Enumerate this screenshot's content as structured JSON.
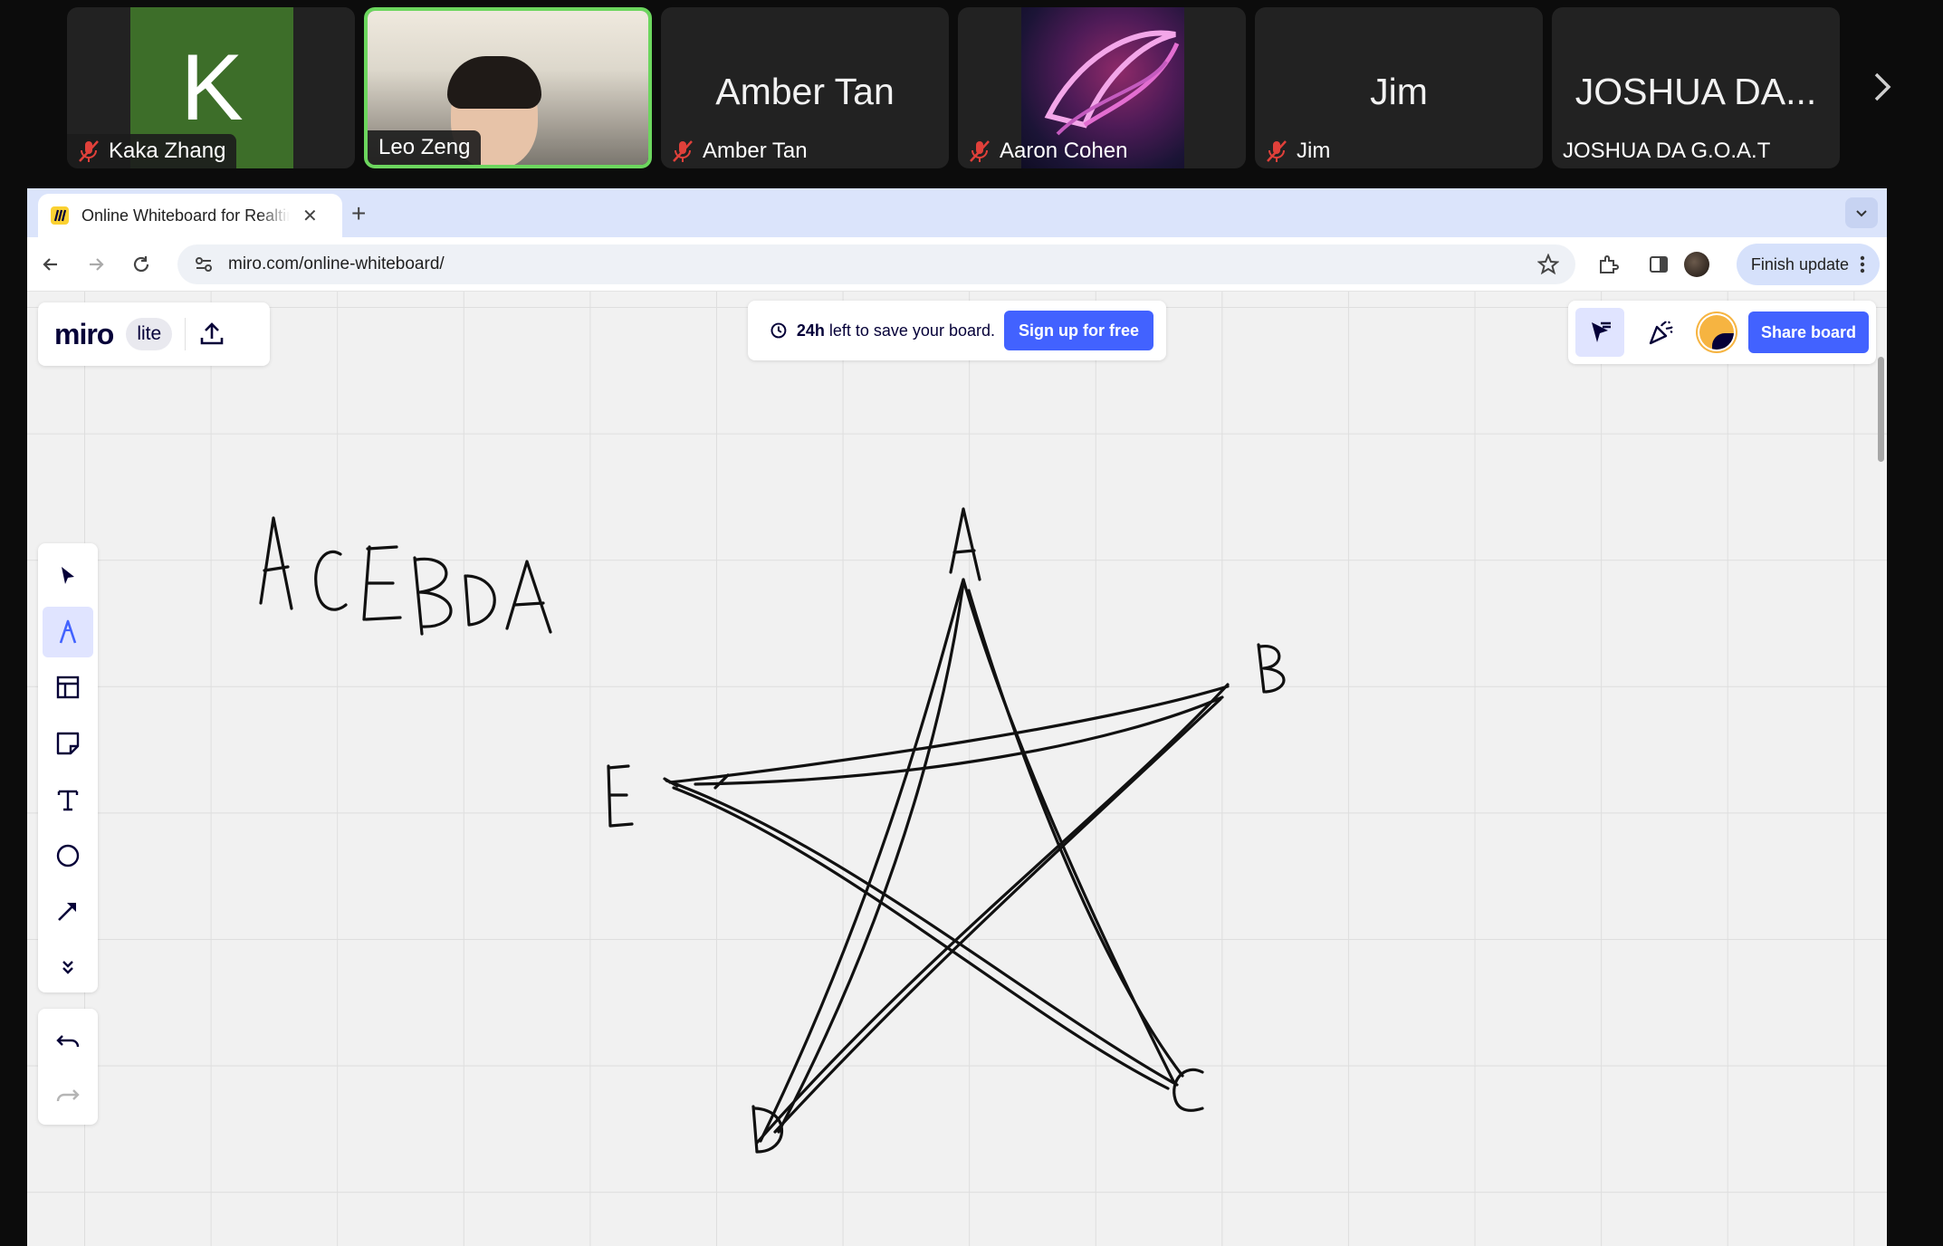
{
  "participants": [
    {
      "display_name": "Kaka Zhang",
      "avatar_letter": "K",
      "muted": true
    },
    {
      "display_name": "Leo Zeng",
      "muted": false,
      "speaking": true
    },
    {
      "display_name": "Amber Tan",
      "center_name": "Amber Tan",
      "muted": true
    },
    {
      "display_name": "Aaron Cohen",
      "muted": true
    },
    {
      "display_name": "Jim",
      "center_name": "Jim",
      "muted": true
    },
    {
      "display_name": "JOSHUA DA G.O.A.T",
      "center_name": "JOSHUA DA..."
    }
  ],
  "browser": {
    "tab_title": "Online Whiteboard for Realtime Collaboration",
    "url": "miro.com/online-whiteboard/",
    "finish_update_label": "Finish update"
  },
  "miro": {
    "logo_text": "miro",
    "plan_badge": "lite",
    "save_notice_bold": "24h",
    "save_notice_rest": " left to save your board.",
    "signup_label": "Sign up for free",
    "share_label": "Share board"
  },
  "left_tools": [
    "select-tool",
    "pen-tool",
    "frame-tool",
    "sticky-note-tool",
    "text-tool",
    "shape-tool",
    "connector-tool",
    "more-tools"
  ],
  "whiteboard": {
    "handwritten_sequence": "ACEBDA",
    "vertex_labels": [
      "A",
      "B",
      "C",
      "D",
      "E"
    ]
  },
  "colors": {
    "accent": "#4262ff",
    "speaking_border": "#6cd65e",
    "mic_muted": "#e0403a",
    "ink": "#111111"
  }
}
